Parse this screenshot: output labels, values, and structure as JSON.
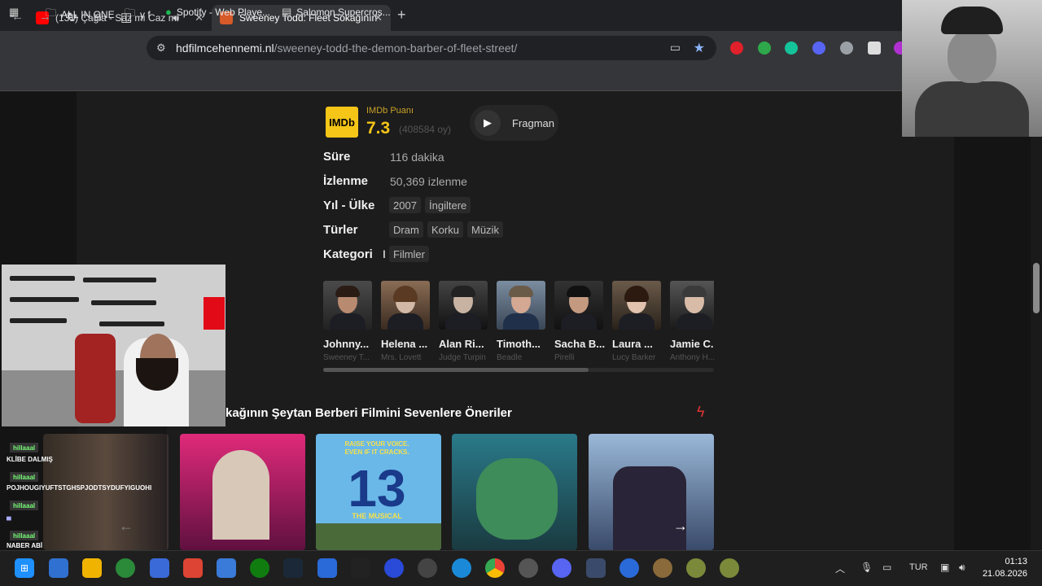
{
  "browser": {
    "tabs": [
      {
        "title": "(131) Çağla - Saz mı Caz mı",
        "active": false,
        "audio": true
      },
      {
        "title": "Sweeney Todd: Fleet Sokağının",
        "active": true,
        "audio": false
      }
    ],
    "address": {
      "host": "hdfilmcehennemi.nl",
      "path": "/sweeney-todd-the-demon-barber-of-fleet-street/"
    },
    "bookmarks": [
      "ALL IN ONE",
      "y f",
      "Spotify - Web Playe...",
      "Salomon Supercros..."
    ]
  },
  "movie": {
    "imdb": {
      "logo": "IMDb",
      "label": "IMDb Puanı",
      "score": "7.3",
      "votes": "(408584 oy)"
    },
    "trailer_label": "Fragman",
    "details": [
      {
        "label": "Süre",
        "value": "116 dakika"
      },
      {
        "label": "İzlenme",
        "value": "50,369 izlenme"
      },
      {
        "label": "Yıl - Ülke",
        "chips": [
          "2007",
          "İngiltere"
        ]
      },
      {
        "label": "Türler",
        "chips": [
          "Dram",
          "Korku",
          "Müzik"
        ]
      },
      {
        "label": "Kategori",
        "chips": [
          "Filmler"
        ]
      }
    ],
    "cast": [
      {
        "name": "Johnny...",
        "role": "Sweeney T..."
      },
      {
        "name": "Helena ...",
        "role": "Mrs. Lovett"
      },
      {
        "name": "Alan Ri...",
        "role": "Judge Turpin"
      },
      {
        "name": "Timoth...",
        "role": "Beadle"
      },
      {
        "name": "Sacha B...",
        "role": "Pirelli"
      },
      {
        "name": "Laura ...",
        "role": "Lucy Barker"
      },
      {
        "name": "Jamie C...",
        "role": "Anthony H..."
      }
    ],
    "cast_scroll_fraction": 0.68
  },
  "recommendations": {
    "title": "kağının Şeytan Berberi Filmini Sevenlere Öneriler",
    "poster_text": [
      "RAISE YOUR VOICE. EVEN IF IT CRACKS.",
      "13",
      "THE MUSICAL"
    ]
  },
  "stream_chat": [
    {
      "user": "hillaaal",
      "msg": "KLİBE DALMIŞ"
    },
    {
      "user": "hillaaal",
      "msg": "POJHOUGIYUFTSTGHSPJODTSYDUFYIGUOHI"
    },
    {
      "user": "hillaaal",
      "msg": ""
    },
    {
      "user": "hillaaal",
      "msg": "NABER ABİ"
    }
  ],
  "taskbar": {
    "lang": "TUR",
    "time": "01:13",
    "date": "21.08.2026"
  }
}
